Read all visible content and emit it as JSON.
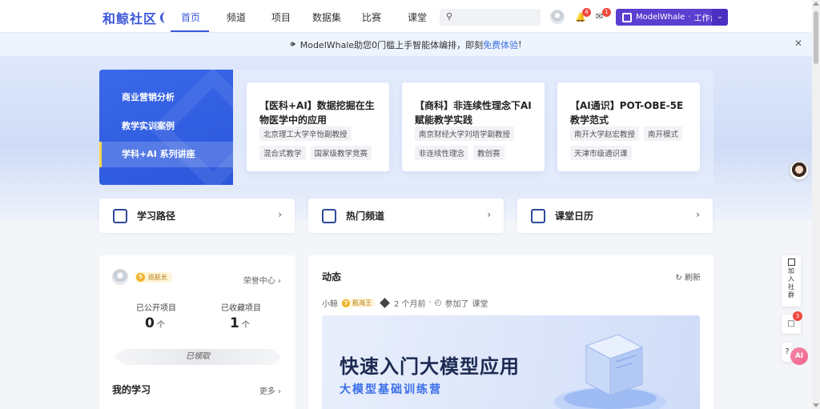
{
  "brand": {
    "name": "和鲸社区",
    "accent": "#3b57d8"
  },
  "nav": {
    "items": [
      "首页",
      "频道",
      "项目",
      "数据集",
      "比赛",
      "课堂"
    ],
    "active_index": 0
  },
  "header": {
    "search_placeholder": "",
    "notifications_count": "4",
    "messages_count": "1",
    "workspace_button": {
      "brand": "ModelWhale",
      "sep": "·",
      "label": "工作台"
    }
  },
  "notice": {
    "text": "ModelWhale助您0门槛上手智能体编排，即刻",
    "link": "免费体验",
    "suffix": "!"
  },
  "hero": {
    "tabs": [
      "商业营销分析",
      "教学实训案例",
      "学科+AI 系列讲座"
    ],
    "active_tab": 2,
    "cards": [
      {
        "title": "【医科+AI】数据挖掘在生物医学中的应用",
        "tags": [
          "北京理工大学辛怡副教授",
          "混合式教学",
          "国家级教学竞赛"
        ]
      },
      {
        "title": "【商科】非连续性理念下AI赋能教学实践",
        "tags": [
          "南京财经大学刘培学副教授",
          "非连续性理念",
          "教创赛"
        ]
      },
      {
        "title": "【AI通识】POT-OBE-5E教学范式",
        "tags": [
          "南开大学赵宏教授",
          "南开模式",
          "天津市级通识课"
        ]
      }
    ]
  },
  "quick_links": [
    {
      "label": "学习路径",
      "icon": "map-icon"
    },
    {
      "label": "热门频道",
      "icon": "grid-icon"
    },
    {
      "label": "课堂日历",
      "icon": "calendar-icon"
    }
  ],
  "profile": {
    "level_num": "5",
    "level_name": "巡航长",
    "honor_center": "荣誉中心",
    "public_projects_label": "已公开项目",
    "public_projects_value": "0",
    "collected_projects_label": "已收藏项目",
    "collected_projects_value": "1",
    "unit": "个",
    "claim_label": "已领取",
    "my_learning": "我的学习",
    "more": "更多"
  },
  "feed": {
    "title": "动态",
    "refresh": "刷新",
    "item": {
      "user": "小鲸",
      "level_num": "7",
      "level_name": "航海王",
      "time": "2 个月前",
      "action": "参加了",
      "target": "课堂",
      "banner_title": "快速入门大模型应用",
      "banner_subtitle": "大模型基础训练营"
    }
  },
  "floating": {
    "join_label": "加入社群",
    "badge_count": "3",
    "ai_label": "AI"
  }
}
